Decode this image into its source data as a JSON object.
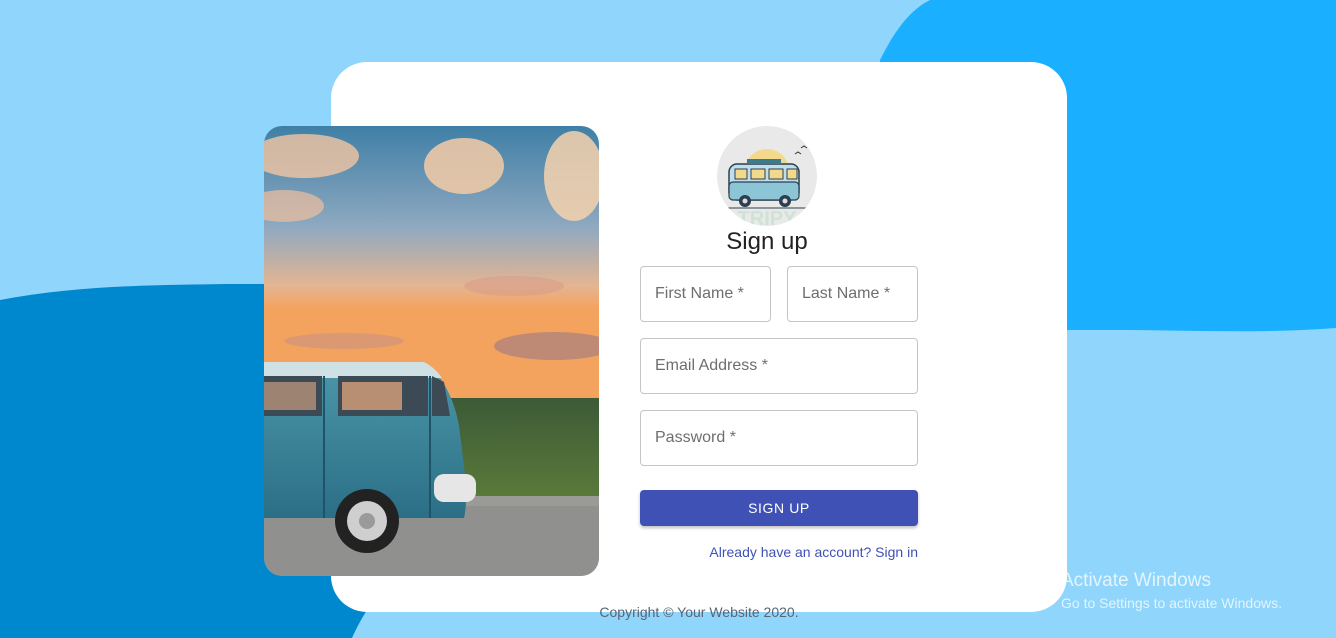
{
  "colors": {
    "page_background": "#90d5fb",
    "shape_dark_blue": "#0088cf",
    "shape_bright_blue": "#1ab0ff",
    "card_background": "#ffffff",
    "primary": "#3f51b5"
  },
  "form": {
    "title": "Sign up",
    "first_name_label": "First Name *",
    "last_name_label": "Last Name *",
    "email_label": "Email Address *",
    "password_label": "Password *",
    "submit_label": "SIGN UP",
    "signin_link": "Already have an account? Sign in"
  },
  "logo": {
    "icon": "camper-van-logo",
    "text": "TRIPY"
  },
  "hero_image": {
    "icon": "camper-van-sunset-photo"
  },
  "footer": {
    "copyright": "Copyright © Your Website 2020."
  },
  "watermark": {
    "title": "Activate Windows",
    "subtitle": "Go to Settings to activate Windows."
  }
}
